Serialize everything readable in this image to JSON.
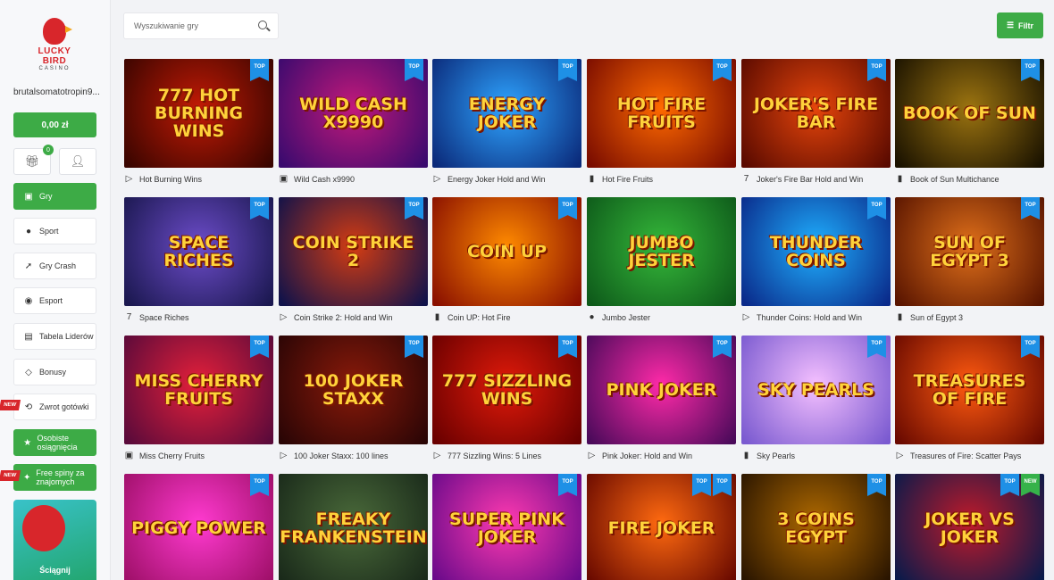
{
  "brand": {
    "name": "LUCKY BIRD",
    "sub": "CASINO"
  },
  "user": {
    "name": "brutalsomatotropin9..."
  },
  "balance": "0,00 zł",
  "gift_badge": "0",
  "nav": [
    {
      "label": "Gry",
      "icon": "gamepad-icon"
    },
    {
      "label": "Sport",
      "icon": "ball-icon"
    },
    {
      "label": "Gry Crash",
      "icon": "rocket-icon"
    },
    {
      "label": "Esport",
      "icon": "controller-icon"
    },
    {
      "label": "Tabela Liderów",
      "icon": "leaderboard-icon"
    },
    {
      "label": "Bonusy",
      "icon": "diamond-icon"
    },
    {
      "label": "Zwrot gotówki",
      "icon": "cashback-icon",
      "badge": "NEW"
    },
    {
      "label": "Osobiste osiągnięcia",
      "icon": "achievement-icon"
    },
    {
      "label": "Free spiny za znajomych",
      "icon": "friends-icon",
      "badge": "NEW"
    }
  ],
  "promo": {
    "text": "Ściągnij"
  },
  "search": {
    "placeholder": "Wyszukiwanie gry"
  },
  "filter": {
    "label": "Filtr"
  },
  "tag_labels": {
    "top": "TOP",
    "new": "NEW"
  },
  "games": [
    {
      "name": "Hot Burning Wins",
      "art": "777 Hot Burning Wins",
      "provider": "flag",
      "colors": [
        "#3a0500",
        "#c21a05"
      ],
      "tags": [
        "top"
      ]
    },
    {
      "name": "Wild Cash x9990",
      "art": "Wild Cash x9990",
      "provider": "square",
      "colors": [
        "#3a0a6e",
        "#c2197a"
      ],
      "tags": [
        "top"
      ]
    },
    {
      "name": "Energy Joker Hold and Win",
      "art": "Energy Joker",
      "provider": "flag",
      "colors": [
        "#0b2a7a",
        "#2ea4ff"
      ],
      "tags": [
        "top"
      ]
    },
    {
      "name": "Hot Fire Fruits",
      "art": "Hot Fire Fruits",
      "provider": "phone",
      "colors": [
        "#7a0c00",
        "#ff6a00"
      ],
      "tags": [
        "top"
      ]
    },
    {
      "name": "Joker's Fire Bar Hold and Win",
      "art": "Joker's Fire Bar",
      "provider": "seven",
      "colors": [
        "#5a0a00",
        "#e5450b"
      ],
      "tags": [
        "top"
      ]
    },
    {
      "name": "Book of Sun Multichance",
      "art": "Book of Sun",
      "provider": "phone",
      "colors": [
        "#1a1200",
        "#9c7410"
      ],
      "tags": [
        "top"
      ]
    },
    {
      "name": "Space Riches",
      "art": "Space Riches",
      "provider": "seven",
      "colors": [
        "#1b1850",
        "#6c4cc9"
      ],
      "tags": [
        "top"
      ]
    },
    {
      "name": "Coin Strike 2: Hold and Win",
      "art": "Coin Strike 2",
      "provider": "flag",
      "colors": [
        "#10124a",
        "#d43c12"
      ],
      "tags": [
        "top"
      ]
    },
    {
      "name": "Coin UP: Hot Fire",
      "art": "Coin Up",
      "provider": "phone",
      "colors": [
        "#8a1000",
        "#ff8a00"
      ],
      "tags": [
        "top"
      ]
    },
    {
      "name": "Jumbo Jester",
      "art": "Jumbo Jester",
      "provider": "pin",
      "colors": [
        "#0e5a1a",
        "#35b83a"
      ],
      "tags": []
    },
    {
      "name": "Thunder Coins: Hold and Win",
      "art": "Thunder Coins",
      "provider": "flag",
      "colors": [
        "#0a2a8a",
        "#1fb0ff"
      ],
      "tags": [
        "top"
      ]
    },
    {
      "name": "Sun of Egypt 3",
      "art": "Sun of Egypt 3",
      "provider": "phone",
      "colors": [
        "#5a1500",
        "#e0701a"
      ],
      "tags": [
        "top"
      ]
    },
    {
      "name": "Miss Cherry Fruits",
      "art": "Miss Cherry Fruits",
      "provider": "square",
      "colors": [
        "#5a0a3a",
        "#e5203a"
      ],
      "tags": [
        "top"
      ]
    },
    {
      "name": "100 Joker Staxx: 100 lines",
      "art": "100 Joker Staxx",
      "provider": "flag",
      "colors": [
        "#2a0505",
        "#8a1a0a"
      ],
      "tags": [
        "top"
      ]
    },
    {
      "name": "777 Sizzling Wins: 5 Lines",
      "art": "777 Sizzling Wins",
      "provider": "flag",
      "colors": [
        "#6a0000",
        "#e01a0a"
      ],
      "tags": [
        "top"
      ]
    },
    {
      "name": "Pink Joker: Hold and Win",
      "art": "Pink Joker",
      "provider": "flag",
      "colors": [
        "#4a0a5a",
        "#ff2aa8"
      ],
      "tags": [
        "top"
      ]
    },
    {
      "name": "Sky Pearls",
      "art": "Sky Pearls",
      "provider": "phone",
      "colors": [
        "#7a5ad0",
        "#f5c0ff"
      ],
      "tags": [
        "top"
      ]
    },
    {
      "name": "Treasures of Fire: Scatter Pays",
      "art": "Treasures of Fire",
      "provider": "flag",
      "colors": [
        "#6a0a00",
        "#ff5a10"
      ],
      "tags": [
        "top"
      ]
    },
    {
      "name": "Piggy Power",
      "art": "Piggy Power",
      "provider": "flag",
      "colors": [
        "#a0106a",
        "#ff3ad0"
      ],
      "tags": [
        "top"
      ]
    },
    {
      "name": "Freaky Frankenstein",
      "art": "Freaky Frankenstein",
      "provider": "flag",
      "colors": [
        "#1a2a1a",
        "#4a6a3a"
      ],
      "tags": []
    },
    {
      "name": "Super Pink Joker",
      "art": "Super Pink Joker",
      "provider": "flag",
      "colors": [
        "#6a0a8a",
        "#ff3ab0"
      ],
      "tags": [
        "top"
      ]
    },
    {
      "name": "Fire Joker",
      "art": "Fire Joker",
      "provider": "flag",
      "colors": [
        "#6a0a00",
        "#ff6a10"
      ],
      "tags": [
        "top",
        "top"
      ]
    },
    {
      "name": "3 Coins Egypt",
      "art": "3 Coins Egypt",
      "provider": "flag",
      "colors": [
        "#2a1500",
        "#b06a00"
      ],
      "tags": [
        "top"
      ]
    },
    {
      "name": "Joker vs Joker",
      "art": "Joker vs Joker",
      "provider": "flag",
      "colors": [
        "#0a1a4a",
        "#c01a2a"
      ],
      "tags": [
        "top",
        "new"
      ]
    }
  ]
}
